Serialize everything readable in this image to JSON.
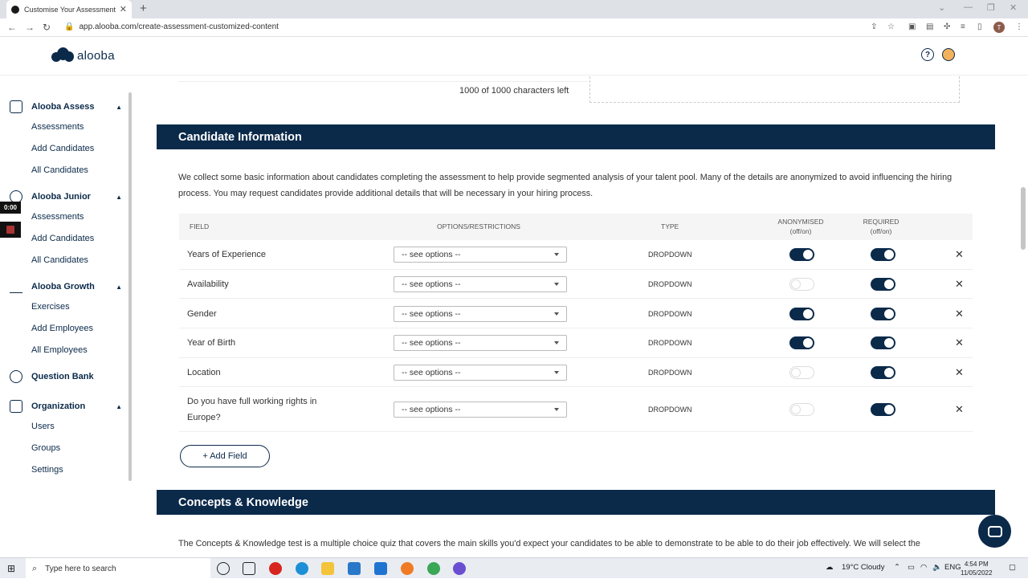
{
  "browser": {
    "tab_title": "Customise Your Assessment | alo",
    "url": "app.alooba.com/create-assessment-customized-content",
    "profile_initial": "T"
  },
  "app": {
    "logo_text": "alooba"
  },
  "sidebar": {
    "timer": "0:00",
    "sections": [
      {
        "label": "Alooba Assess",
        "items": [
          "Assessments",
          "Add Candidates",
          "All Candidates"
        ]
      },
      {
        "label": "Alooba Junior",
        "items": [
          "Assessments",
          "Add Candidates",
          "All Candidates"
        ]
      },
      {
        "label": "Alooba Growth",
        "items": [
          "Exercises",
          "Add Employees",
          "All Employees"
        ]
      },
      {
        "label": "Question Bank",
        "items": []
      },
      {
        "label": "Organization",
        "items": [
          "Users",
          "Groups",
          "Settings"
        ]
      }
    ]
  },
  "main": {
    "chars_left": "1000 of 1000 characters left",
    "candidate_info": {
      "title": "Candidate Information",
      "description": "We collect some basic information about candidates completing the assessment to help provide segmented analysis of your talent pool. Many of the details are anonymized to avoid influencing the hiring process. You may request candidates provide additional details that will be necessary in your hiring process.",
      "headers": {
        "field": "FIELD",
        "options": "OPTIONS/RESTRICTIONS",
        "type": "TYPE",
        "anon": "ANONYMISED",
        "anon_sub": "(off/on)",
        "req": "REQUIRED",
        "req_sub": "(off/on)"
      },
      "rows": [
        {
          "field": "Years of Experience",
          "option": "-- see options --",
          "type": "DROPDOWN",
          "anonymised": true,
          "required": true
        },
        {
          "field": "Availability",
          "option": "-- see options --",
          "type": "DROPDOWN",
          "anonymised": false,
          "required": true
        },
        {
          "field": "Gender",
          "option": "-- see options --",
          "type": "DROPDOWN",
          "anonymised": true,
          "required": true
        },
        {
          "field": "Year of Birth",
          "option": "-- see options --",
          "type": "DROPDOWN",
          "anonymised": true,
          "required": true
        },
        {
          "field": "Location",
          "option": "-- see options --",
          "type": "DROPDOWN",
          "anonymised": false,
          "required": true
        },
        {
          "field": "Do you have full working rights in Europe?",
          "option": "-- see options --",
          "type": "DROPDOWN",
          "anonymised": false,
          "required": true
        }
      ],
      "add_field_label": "+ Add Field"
    },
    "concepts": {
      "title": "Concepts & Knowledge",
      "description": "The Concepts & Knowledge test is a multiple choice quiz that covers the main skills you'd expect your candidates to be able to demonstrate to be able to do their job effectively. We will select the"
    }
  },
  "taskbar": {
    "search_placeholder": "Type here to search",
    "weather": "19°C  Cloudy",
    "lang": "ENG",
    "time": "4:54 PM",
    "date": "11/05/2022"
  }
}
